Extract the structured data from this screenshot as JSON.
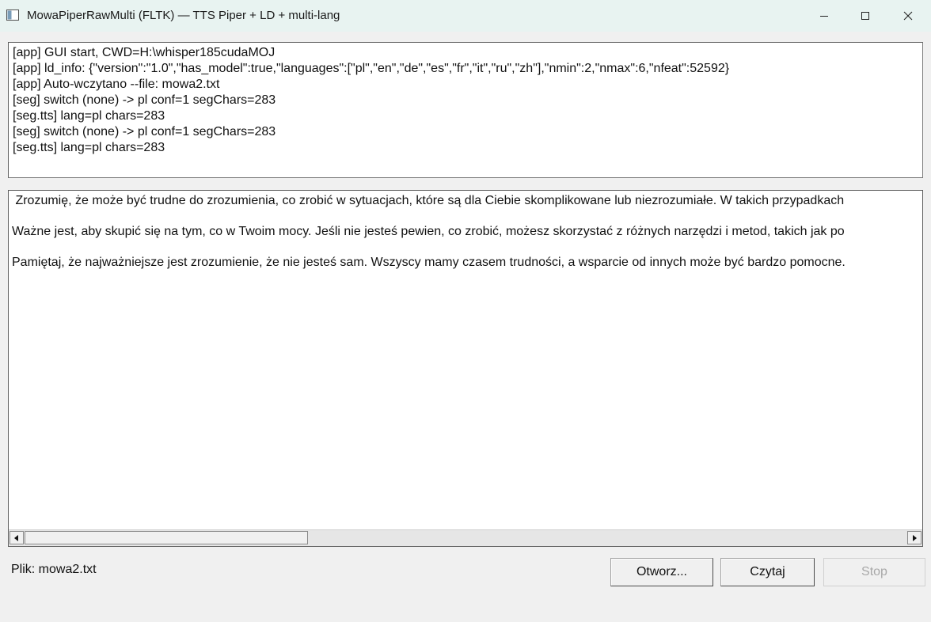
{
  "window": {
    "title": "MowaPiperRawMulti (FLTK) — TTS Piper + LD + multi-lang"
  },
  "log": {
    "lines": [
      "[app] GUI start, CWD=H:\\whisper185cudaMOJ",
      "[app] ld_info: {\"version\":\"1.0\",\"has_model\":true,\"languages\":[\"pl\",\"en\",\"de\",\"es\",\"fr\",\"it\",\"ru\",\"zh\"],\"nmin\":2,\"nmax\":6,\"nfeat\":52592}",
      "[app] Auto-wczytano --file: mowa2.txt",
      "[seg] switch (none) -> pl conf=1 segChars=283",
      "[seg.tts] lang=pl chars=283",
      "[seg] switch (none) -> pl conf=1 segChars=283",
      "[seg.tts] lang=pl chars=283"
    ]
  },
  "editor": {
    "paragraphs": [
      " Zrozumię, że może być trudne do zrozumienia, co zrobić w sytuacjach, które są dla Ciebie skomplikowane lub niezrozumiałe. W takich przypadkach",
      "Ważne jest, aby skupić się na tym, co w Twoim mocy. Jeśli nie jesteś pewien, co zrobić, możesz skorzystać z różnych narzędzi i metod, takich jak po",
      "Pamiętaj, że najważniejsze jest zrozumienie, że nie jesteś sam. Wszyscy mamy czasem trudności, a wsparcie od innych może być bardzo pomocne."
    ]
  },
  "footer": {
    "file_label": "Plik: mowa2.txt",
    "open_label": "Otworz...",
    "read_label": "Czytaj",
    "stop_label": "Stop"
  },
  "colors": {
    "titlebar": "#e8f3f1",
    "window_bg": "#f0f0f0",
    "disabled_text": "#a8a8a8"
  },
  "icons": {
    "app": "app-window-icon",
    "minimize": "minimize-icon",
    "maximize": "maximize-icon",
    "close": "close-icon",
    "scroll_left": "arrow-left-icon",
    "scroll_right": "arrow-right-icon"
  }
}
